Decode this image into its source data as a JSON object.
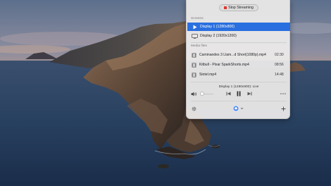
{
  "panel": {
    "stop_button_label": "Stop Streaming",
    "screens_label": "Screens",
    "screens": [
      {
        "label": "Display 1 (1280x800)",
        "selected": true,
        "icon": "play-icon"
      },
      {
        "label": "Display 2 (1920x1200)",
        "selected": false,
        "icon": "display-icon"
      }
    ],
    "media_label": "Media files",
    "media": [
      {
        "name": "Caminandes 3  Llam...d Short(1080p).mp4",
        "duration": "02:30",
        "icon": "film-icon"
      },
      {
        "name": "Kitbull - Pixar SparkShorts.mp4",
        "duration": "08:56",
        "icon": "film-icon"
      },
      {
        "name": "Sintel.mp4",
        "duration": "14:48",
        "icon": "film-icon"
      }
    ],
    "now_playing": "Display 1 (1280x800): Live",
    "volume_level": 0.1,
    "colors": {
      "accent": "#2a6fdf",
      "stop": "#e3322b",
      "airplay": "#3f7ef0"
    }
  }
}
